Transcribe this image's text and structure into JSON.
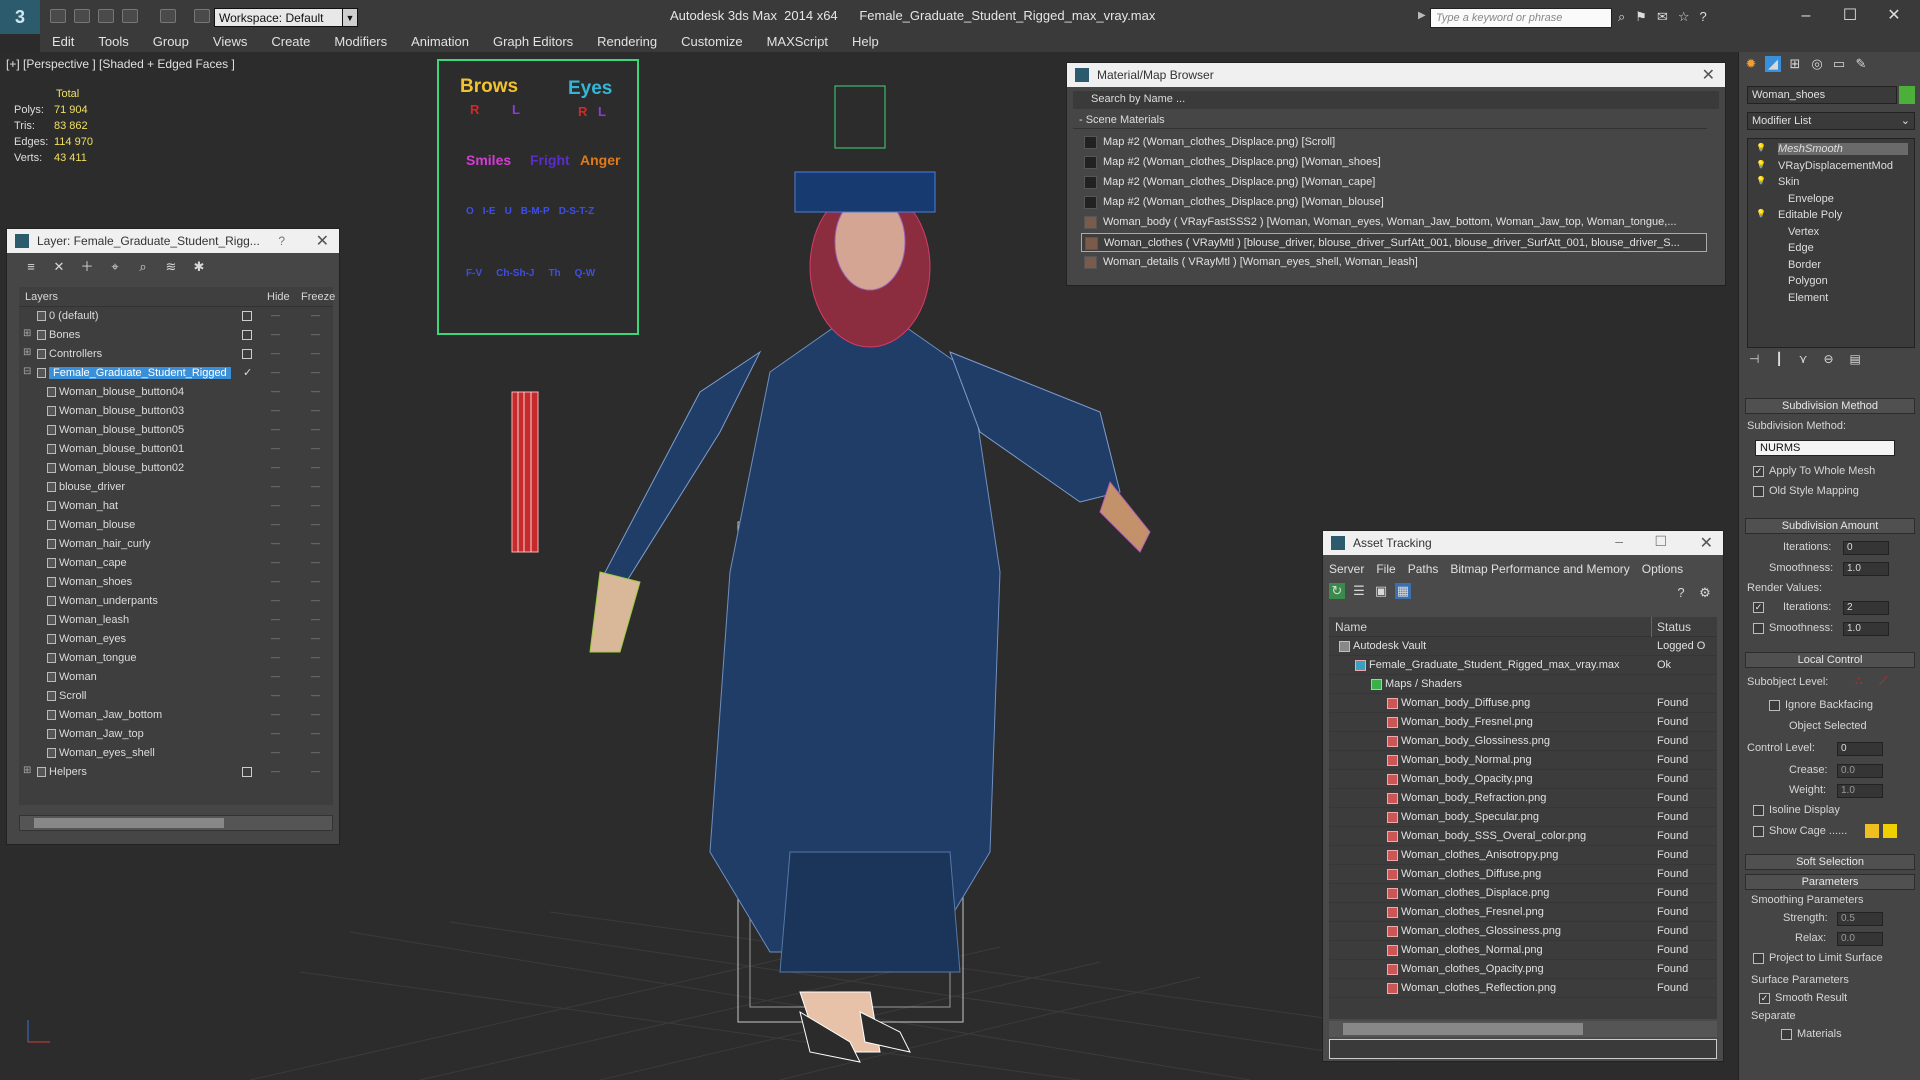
{
  "titlebar": {
    "workspace": "Workspace: Default",
    "app_title": "Autodesk 3ds Max  2014 x64      Female_Graduate_Student_Rigged_max_vray.max",
    "search_placeholder": "Type a keyword or phrase"
  },
  "menu": [
    "Edit",
    "Tools",
    "Group",
    "Views",
    "Create",
    "Modifiers",
    "Animation",
    "Graph Editors",
    "Rendering",
    "Customize",
    "MAXScript",
    "Help"
  ],
  "viewport": {
    "label": "[+] [Perspective ] [Shaded + Edged Faces ]",
    "stats_header": "Total",
    "stats": [
      {
        "k": "Polys:",
        "v": "71 904"
      },
      {
        "k": "Tris:",
        "v": "83 862"
      },
      {
        "k": "Edges:",
        "v": "114 970"
      },
      {
        "k": "Verts:",
        "v": "43 411"
      }
    ],
    "facial_board": {
      "brows": "Brows",
      "eyes": "Eyes",
      "r": "R",
      "l": "L",
      "smiles": "Smiles",
      "fright": "Fright",
      "anger": "Anger",
      "row3": [
        "O",
        "I-E",
        "U",
        "B-M-P",
        "D-S-T-Z"
      ],
      "row4": [
        "F-V",
        "Ch-Sh-J",
        "Th",
        "Q-W"
      ]
    }
  },
  "layer_panel": {
    "title": "Layer: Female_Graduate_Student_Rigg...",
    "help": "?",
    "col_layers": "Layers",
    "col_hide": "Hide",
    "col_freeze": "Freeze",
    "rows": [
      {
        "name": "0 (default)",
        "level": 0,
        "expander": "",
        "box": true
      },
      {
        "name": "Bones",
        "level": 0,
        "expander": "⊞",
        "box": true
      },
      {
        "name": "Controllers",
        "level": 0,
        "expander": "⊞",
        "box": true
      },
      {
        "name": "Female_Graduate_Student_Rigged",
        "level": 0,
        "expander": "⊟",
        "box": false,
        "selected": true,
        "current": "✓"
      },
      {
        "name": "Woman_blouse_button04",
        "level": 1
      },
      {
        "name": "Woman_blouse_button03",
        "level": 1
      },
      {
        "name": "Woman_blouse_button05",
        "level": 1
      },
      {
        "name": "Woman_blouse_button01",
        "level": 1
      },
      {
        "name": "Woman_blouse_button02",
        "level": 1
      },
      {
        "name": "blouse_driver",
        "level": 1
      },
      {
        "name": "Woman_hat",
        "level": 1
      },
      {
        "name": "Woman_blouse",
        "level": 1
      },
      {
        "name": "Woman_hair_curly",
        "level": 1
      },
      {
        "name": "Woman_cape",
        "level": 1
      },
      {
        "name": "Woman_shoes",
        "level": 1
      },
      {
        "name": "Woman_underpants",
        "level": 1
      },
      {
        "name": "Woman_leash",
        "level": 1
      },
      {
        "name": "Woman_eyes",
        "level": 1
      },
      {
        "name": "Woman_tongue",
        "level": 1
      },
      {
        "name": "Woman",
        "level": 1
      },
      {
        "name": "Scroll",
        "level": 1
      },
      {
        "name": "Woman_Jaw_bottom",
        "level": 1
      },
      {
        "name": "Woman_Jaw_top",
        "level": 1
      },
      {
        "name": "Woman_eyes_shell",
        "level": 1
      },
      {
        "name": "Helpers",
        "level": 0,
        "expander": "⊞",
        "box": true
      }
    ]
  },
  "material_browser": {
    "title": "Material/Map Browser",
    "search_placeholder": "Search by Name ...",
    "section": "- Scene Materials",
    "rows": [
      "Map #2 (Woman_clothes_Displace.png) [Scroll]",
      "Map #2 (Woman_clothes_Displace.png) [Woman_shoes]",
      "Map #2 (Woman_clothes_Displace.png) [Woman_cape]",
      "Map #2 (Woman_clothes_Displace.png) [Woman_blouse]",
      "Woman_body  ( VRayFastSSS2 ) [Woman, Woman_eyes, Woman_Jaw_bottom, Woman_Jaw_top, Woman_tongue,...",
      "Woman_clothes  ( VRayMtl ) [blouse_driver, blouse_driver_SurfAtt_001, blouse_driver_SurfAtt_001, blouse_driver_S...",
      "Woman_details  ( VRayMtl ) [Woman_eyes_shell, Woman_leash]"
    ],
    "selected_index": 5
  },
  "asset_tracking": {
    "title": "Asset Tracking",
    "menu": [
      "Server",
      "File",
      "Paths",
      "Bitmap Performance and Memory",
      "Options"
    ],
    "col_name": "Name",
    "col_status": "Status",
    "rows": [
      {
        "name": "Autodesk Vault",
        "status": "Logged O",
        "indent": 24,
        "icon": "vault"
      },
      {
        "name": "Female_Graduate_Student_Rigged_max_vray.max",
        "status": "Ok",
        "indent": 40,
        "icon": "max"
      },
      {
        "name": "Maps / Shaders",
        "status": "",
        "indent": 56,
        "icon": "folder"
      },
      {
        "name": "Woman_body_Diffuse.png",
        "status": "Found",
        "indent": 72,
        "icon": "png"
      },
      {
        "name": "Woman_body_Fresnel.png",
        "status": "Found",
        "indent": 72,
        "icon": "png"
      },
      {
        "name": "Woman_body_Glossiness.png",
        "status": "Found",
        "indent": 72,
        "icon": "png"
      },
      {
        "name": "Woman_body_Normal.png",
        "status": "Found",
        "indent": 72,
        "icon": "png"
      },
      {
        "name": "Woman_body_Opacity.png",
        "status": "Found",
        "indent": 72,
        "icon": "png"
      },
      {
        "name": "Woman_body_Refraction.png",
        "status": "Found",
        "indent": 72,
        "icon": "png"
      },
      {
        "name": "Woman_body_Specular.png",
        "status": "Found",
        "indent": 72,
        "icon": "png"
      },
      {
        "name": "Woman_body_SSS_Overal_color.png",
        "status": "Found",
        "indent": 72,
        "icon": "png"
      },
      {
        "name": "Woman_clothes_Anisotropy.png",
        "status": "Found",
        "indent": 72,
        "icon": "png"
      },
      {
        "name": "Woman_clothes_Diffuse.png",
        "status": "Found",
        "indent": 72,
        "icon": "png"
      },
      {
        "name": "Woman_clothes_Displace.png",
        "status": "Found",
        "indent": 72,
        "icon": "png"
      },
      {
        "name": "Woman_clothes_Fresnel.png",
        "status": "Found",
        "indent": 72,
        "icon": "png"
      },
      {
        "name": "Woman_clothes_Glossiness.png",
        "status": "Found",
        "indent": 72,
        "icon": "png"
      },
      {
        "name": "Woman_clothes_Normal.png",
        "status": "Found",
        "indent": 72,
        "icon": "png"
      },
      {
        "name": "Woman_clothes_Opacity.png",
        "status": "Found",
        "indent": 72,
        "icon": "png"
      },
      {
        "name": "Woman_clothes_Reflection.png",
        "status": "Found",
        "indent": 72,
        "icon": "png"
      }
    ]
  },
  "command_panel": {
    "object_name": "Woman_shoes",
    "object_color": "#4caf3a",
    "modifier_list": "Modifier List",
    "stack": [
      {
        "label": "MeshSmooth",
        "italic": true
      },
      {
        "label": "VRayDisplacementMod"
      },
      {
        "label": "Skin"
      },
      {
        "label": "Envelope",
        "sub": true
      },
      {
        "label": "Editable Poly"
      },
      {
        "label": "Vertex",
        "sub": true
      },
      {
        "label": "Edge",
        "sub": true
      },
      {
        "label": "Border",
        "sub": true
      },
      {
        "label": "Polygon",
        "sub": true
      },
      {
        "label": "Element",
        "sub": true
      }
    ],
    "subdivision_method_rollout": "Subdivision Method",
    "subdivision_method_label": "Subdivision Method:",
    "subdivision_method_value": "NURMS",
    "apply_whole_mesh": "Apply To Whole Mesh",
    "old_style_mapping": "Old Style Mapping",
    "subdivision_amount_rollout": "Subdivision Amount",
    "iterations_label": "Iterations:",
    "iterations_value": "0",
    "smoothness_label": "Smoothness:",
    "smoothness_value": "1.0",
    "render_values_label": "Render Values:",
    "render_iterations_label": "Iterations:",
    "render_iterations_value": "2",
    "render_smoothness_label": "Smoothness:",
    "render_smoothness_value": "1.0",
    "local_control_rollout": "Local Control",
    "subobject_level_label": "Subobject Level:",
    "ignore_backfacing": "Ignore Backfacing",
    "object_selected": "Object Selected",
    "control_level_label": "Control Level:",
    "control_level_value": "0",
    "crease_label": "Crease:",
    "crease_value": "0.0",
    "weight_label": "Weight:",
    "weight_value": "1.0",
    "isoline_display": "Isoline Display",
    "show_cage": "Show Cage ......",
    "soft_selection_rollout": "Soft Selection",
    "parameters_rollout": "Parameters",
    "smoothing_parameters": "Smoothing Parameters",
    "strength_label": "Strength:",
    "strength_value": "0.5",
    "relax_label": "Relax:",
    "relax_value": "0.0",
    "project_limit": "Project to Limit Surface",
    "surface_parameters": "Surface Parameters",
    "smooth_result": "Smooth Result",
    "separate_label": "Separate",
    "materials_label": "Materials"
  }
}
